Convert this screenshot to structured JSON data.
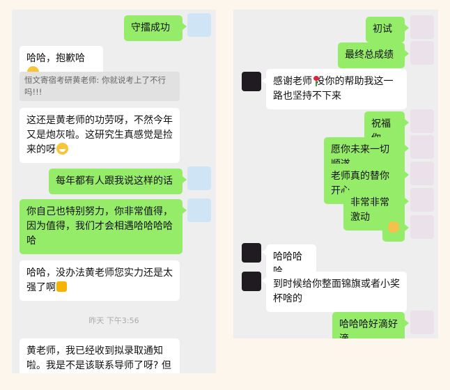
{
  "left_chat": {
    "msg1": "守擂成功",
    "msg2": "哈哈，抱歉哈",
    "quote": "恒文寄宿考研黄老师: 你就说考上了不行吗!!!",
    "msg3": "这还是黄老师的功劳呀，不然今年又是炮灰啦。这研究生真感觉是捡来的呀",
    "msg4": "每年都有人跟我说这样的话",
    "msg5": "你自己也特别努力，你非常值得，因为值得，我们才会相遇哈哈哈哈哈",
    "msg6": "哈哈，没办法黄老师您实力还是太强了啊",
    "timestamp": "昨天 下午3:56",
    "msg7": "黄老师，我已经收到拟录取通知啦。我是不是该联系导师了呀? 但是我"
  },
  "right_chat": {
    "msg1": "初试",
    "msg2": "最终总成绩",
    "msg3": "感谢老师  没你的帮助我这一路也坚持不下来",
    "msg4": "祝福你",
    "msg5": "愿你未来一切顺遂",
    "msg6": "老师真的替你开心",
    "msg7": "非常非常激动",
    "msg9": "哈哈哈哈",
    "msg10": "到时候给你整面锦旗或者小奖杯啥的",
    "msg11": "哈哈哈好滴好滴"
  },
  "icons": {
    "grin": "grinning-face-emoji",
    "laugh": "tears-of-joy-emoji",
    "thumb": "thumbs-up-emoji",
    "rose": "rose-emoji",
    "doge": "doge-sticker"
  },
  "colors": {
    "sent_bubble": "#95ec69",
    "received_bubble": "#ffffff",
    "chat_bg": "#eeeeee",
    "page_bg": "#fdf6ec"
  }
}
